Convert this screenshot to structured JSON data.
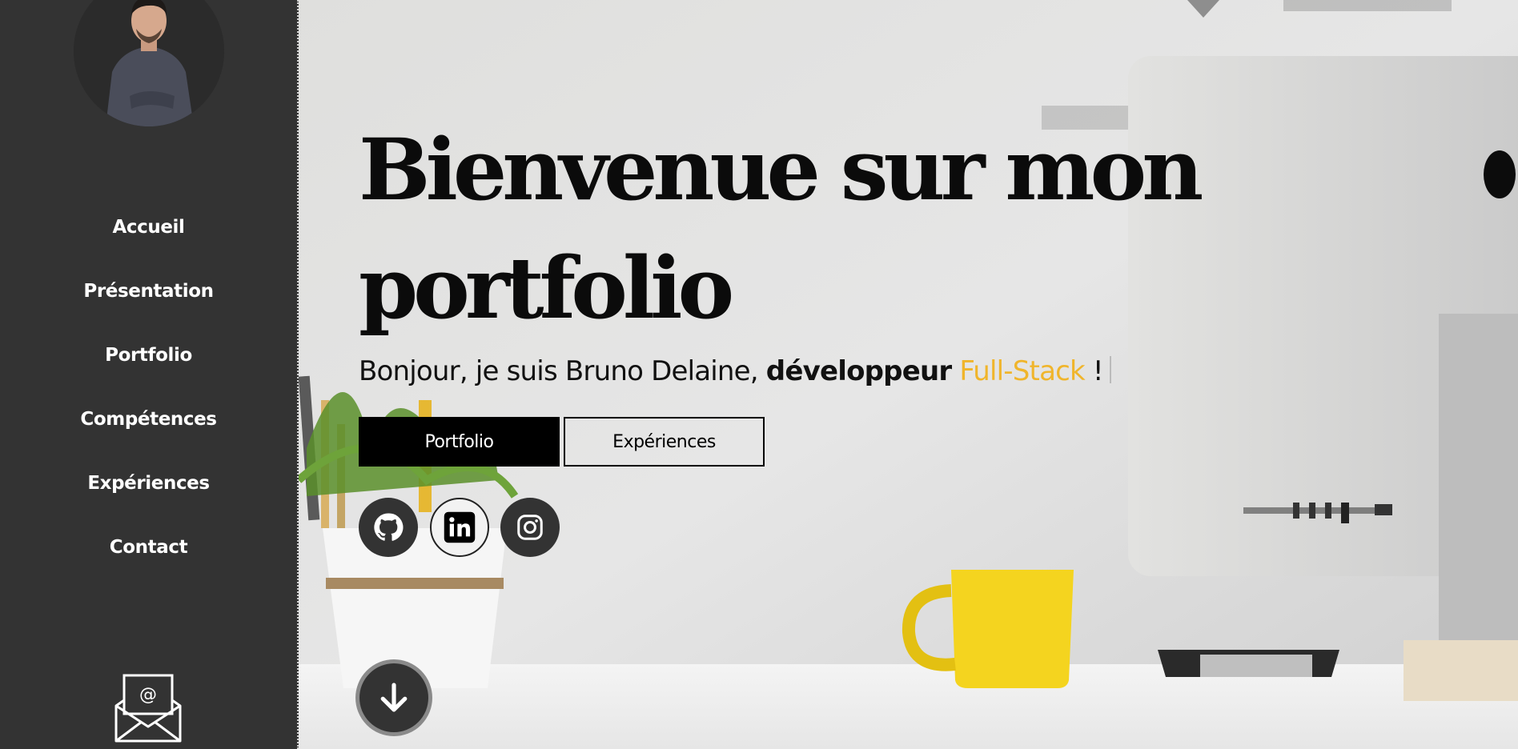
{
  "sidebar": {
    "nav": [
      {
        "label": "Accueil"
      },
      {
        "label": "Présentation"
      },
      {
        "label": "Portfolio"
      },
      {
        "label": "Compétences"
      },
      {
        "label": "Expériences"
      },
      {
        "label": "Contact"
      }
    ],
    "mail_icon": "envelope-at-icon",
    "background": "#333333"
  },
  "hero": {
    "title": "Bienvenue sur mon portfolio",
    "subtitle": {
      "intro": "Bonjour, je suis Bruno Delaine, ",
      "role": "développeur",
      "space": " ",
      "specialty": "Full-Stack",
      "suffix": " !"
    },
    "buttons": {
      "primary": "Portfolio",
      "secondary": "Expériences"
    },
    "social": [
      "github-icon",
      "linkedin-icon",
      "instagram-icon"
    ],
    "scroll_icon": "arrow-down-icon",
    "accent_color": "#f0b52b"
  }
}
